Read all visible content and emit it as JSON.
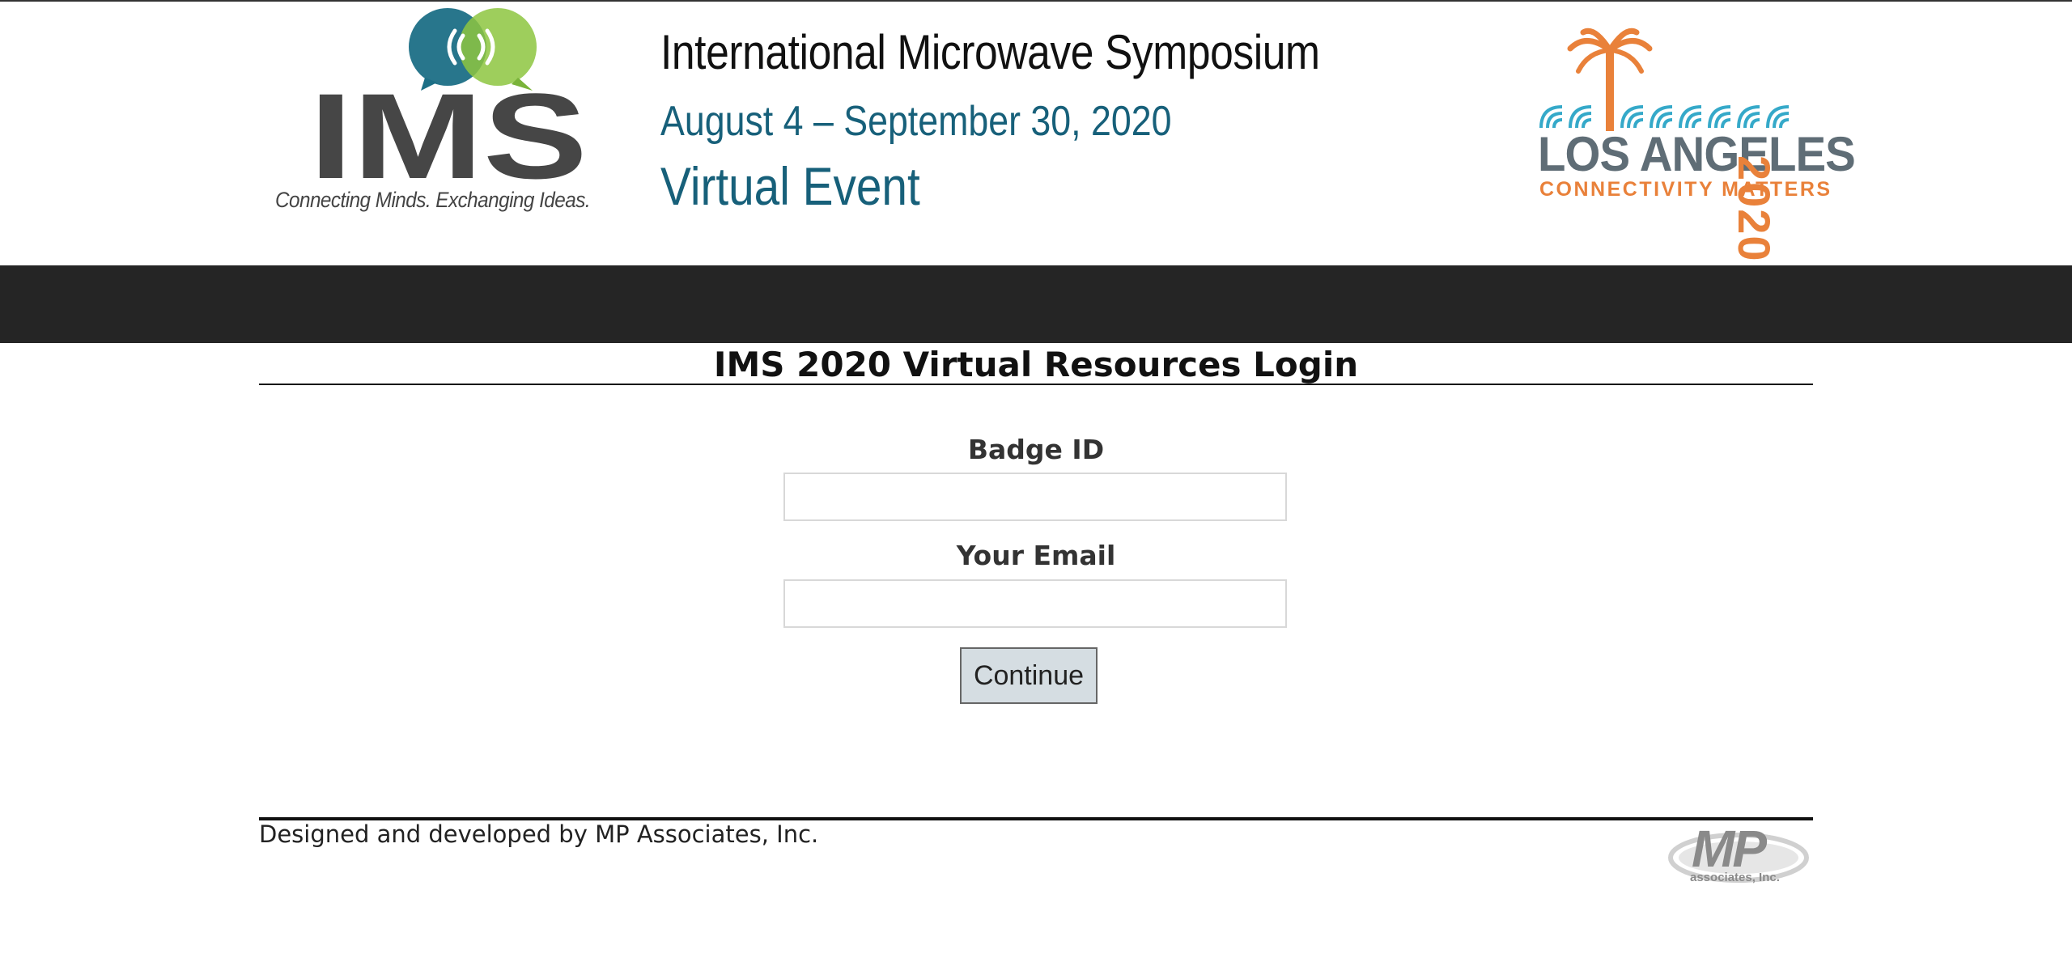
{
  "header": {
    "ims_logo_text": "IMS",
    "ims_tagline": "Connecting Minds. Exchanging Ideas.",
    "event_title": "International Microwave Symposium",
    "event_dates": "August 4 – September 30, 2020",
    "event_type": "Virtual Event",
    "la_logo_name": "LOS ANGELES",
    "la_logo_year": "2020",
    "la_logo_tagline": "CONNECTIVITY MATTERS"
  },
  "main": {
    "title": "IMS 2020 Virtual Resources Login",
    "badge_label": "Badge ID",
    "badge_value": "",
    "email_label": "Your Email",
    "email_value": "",
    "continue_label": "Continue"
  },
  "footer": {
    "credit": "Designed and developed by MP Associates, Inc.",
    "mp_logo_text": "MP",
    "mp_logo_sub": "associates, Inc."
  },
  "colors": {
    "nav_bar": "#252525",
    "ims_teal": "#17607a",
    "ims_green": "#8dc63f",
    "la_orange": "#e9813a",
    "la_blue": "#35a9c9",
    "la_gray": "#5f6d76",
    "button_bg": "#d5dde2"
  },
  "icons": {
    "ims_logo": "ims-speech-bubbles-logo",
    "la_logo": "palm-tree-waves-logo",
    "mp_logo": "mp-associates-swoosh-logo"
  }
}
